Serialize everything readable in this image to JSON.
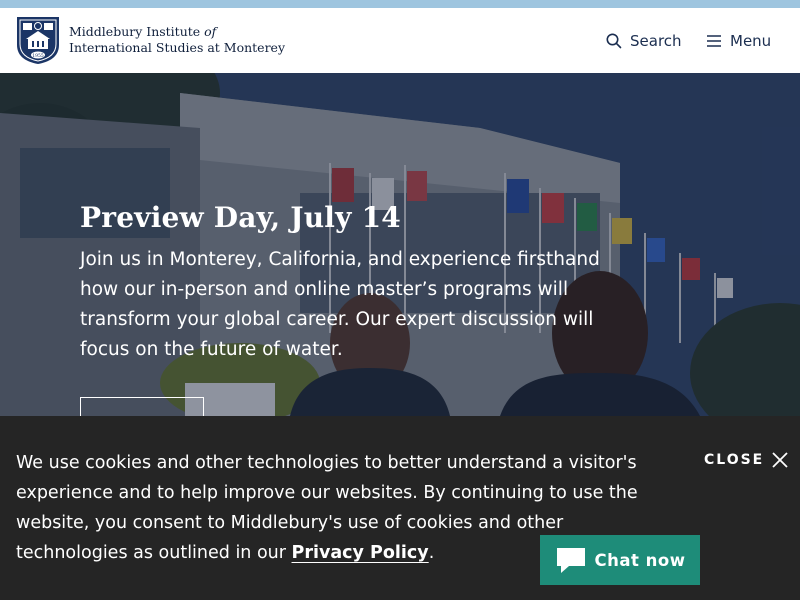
{
  "header": {
    "logo_line1": "Middlebury Institute ",
    "logo_line1_italic": "of",
    "logo_line2": "International Studies at Monterey",
    "seal_year": "1955",
    "search_label": "Search",
    "menu_label": "Menu"
  },
  "hero": {
    "title": "Preview Day, July 14",
    "description": "Join us in Monterey, California, and experience firsthand how our in-person and online master’s programs will transform your global career. Our expert discussion will focus on the future of water."
  },
  "cookie_banner": {
    "text_before_link": "We use cookies and other technologies to better understand a visitor's experience and to help improve our websites. By continuing to use the website, you consent to Middlebury's use of cookies and other technologies as outlined in our ",
    "link_text": "Privacy Policy",
    "text_after_link": ".",
    "close_label": "CLOSE"
  },
  "chat": {
    "label": "Chat now"
  },
  "colors": {
    "top_strip": "#9ec5df",
    "header_text": "#1b2e50",
    "cookie_bg": "#252525",
    "chat_bg": "#1e8c79"
  },
  "icons": {
    "search": "search-icon",
    "menu": "hamburger-icon",
    "close": "close-icon",
    "chat": "chat-bubble-icon",
    "logo": "institute-seal-icon"
  }
}
